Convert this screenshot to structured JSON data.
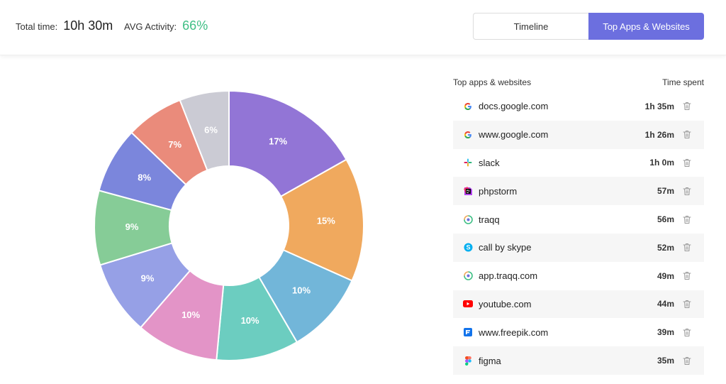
{
  "header": {
    "total_label": "Total time:",
    "total_value": "10h 30m",
    "avg_label": "AVG Activity:",
    "avg_value": "66%",
    "tabs": [
      {
        "label": "Timeline",
        "active": false
      },
      {
        "label": "Top Apps & Websites",
        "active": true
      }
    ]
  },
  "chart_data": {
    "type": "pie",
    "donut": true,
    "categories": [
      "docs.google.com",
      "www.google.com",
      "slack",
      "phpstorm",
      "traqq",
      "call by skype",
      "app.traqq.com",
      "youtube.com",
      "www.freepik.com",
      "figma"
    ],
    "values": [
      17,
      15,
      10,
      10,
      10,
      9,
      9,
      8,
      7,
      6
    ],
    "labels": [
      "17%",
      "15%",
      "10%",
      "10%",
      "10%",
      "9%",
      "9%",
      "8%",
      "7%",
      "6%"
    ],
    "colors": [
      "#9275d6",
      "#f0a95e",
      "#72b6d9",
      "#6ccdc0",
      "#e394c7",
      "#96a0e6",
      "#86cc97",
      "#7b86dc",
      "#ea8b7b",
      "#cbcbd4"
    ]
  },
  "list": {
    "header_left": "Top apps & websites",
    "header_right": "Time spent",
    "items": [
      {
        "name": "docs.google.com",
        "time": "1h 35m",
        "icon": "google-icon"
      },
      {
        "name": "www.google.com",
        "time": "1h 26m",
        "icon": "google-icon"
      },
      {
        "name": "slack",
        "time": "1h 0m",
        "icon": "slack-icon"
      },
      {
        "name": "phpstorm",
        "time": "57m",
        "icon": "phpstorm-icon"
      },
      {
        "name": "traqq",
        "time": "56m",
        "icon": "traqq-icon"
      },
      {
        "name": "call by skype",
        "time": "52m",
        "icon": "skype-icon"
      },
      {
        "name": "app.traqq.com",
        "time": "49m",
        "icon": "traqq-icon"
      },
      {
        "name": "youtube.com",
        "time": "44m",
        "icon": "youtube-icon"
      },
      {
        "name": "www.freepik.com",
        "time": "39m",
        "icon": "freepik-icon"
      },
      {
        "name": "figma",
        "time": "35m",
        "icon": "figma-icon"
      }
    ]
  }
}
